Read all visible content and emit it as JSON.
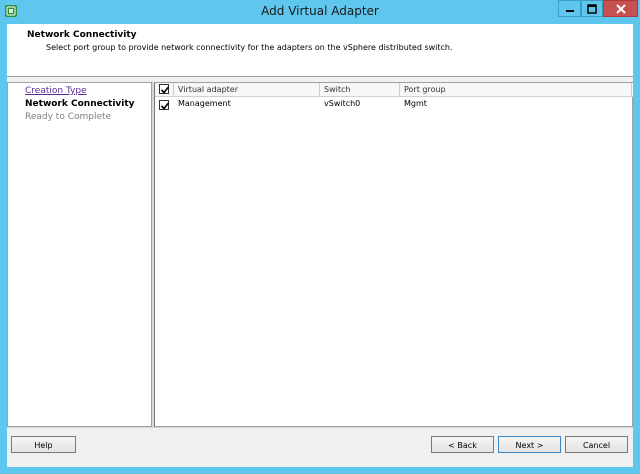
{
  "window": {
    "title": "Add Virtual Adapter",
    "app_icon": "vsphere-icon",
    "controls": [
      "minimize-icon",
      "maximize-icon",
      "close-icon"
    ],
    "accent": "#5fc6ee"
  },
  "header": {
    "title": "Network Connectivity",
    "subtitle": "Select port group to provide network connectivity for the adapters on the vSphere distributed switch."
  },
  "steps": [
    {
      "label": "Creation Type",
      "state": "done"
    },
    {
      "label": "Network Connectivity",
      "state": "current"
    },
    {
      "label": "Ready to Complete",
      "state": "pending"
    }
  ],
  "table": {
    "header_checked": true,
    "columns": [
      "Virtual adapter",
      "Switch",
      "Port group"
    ],
    "rows": [
      {
        "checked": true,
        "adapter": "Management",
        "switch": "vSwitch0",
        "port_group": "Mgmt"
      }
    ]
  },
  "buttons": {
    "help": "Help",
    "back": "< Back",
    "next": "Next >",
    "cancel": "Cancel"
  }
}
